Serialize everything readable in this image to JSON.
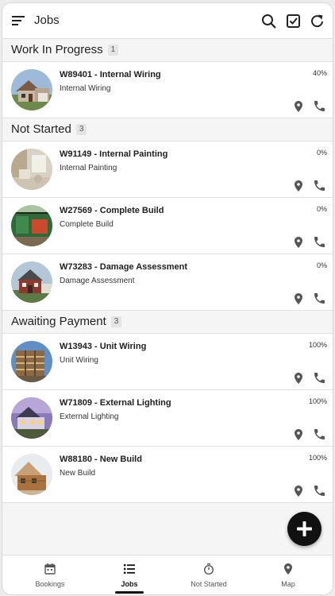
{
  "header": {
    "title": "Jobs",
    "menu_icon": "menu-icon",
    "actions": [
      "search-icon",
      "checklist-icon",
      "refresh-icon"
    ]
  },
  "sections": [
    {
      "title": "Work In Progress",
      "count": "1",
      "jobs": [
        {
          "name": "W89401 - Internal Wiring",
          "type": "Internal Wiring",
          "progress": "40%"
        }
      ]
    },
    {
      "title": "Not Started",
      "count": "3",
      "jobs": [
        {
          "name": "W91149 - Internal Painting",
          "type": "Internal Painting",
          "progress": "0%"
        },
        {
          "name": "W27569 - Complete Build",
          "type": "Complete Build",
          "progress": "0%"
        },
        {
          "name": "W73283 - Damage Assessment",
          "type": "Damage Assessment",
          "progress": "0%"
        }
      ]
    },
    {
      "title": "Awaiting Payment",
      "count": "3",
      "jobs": [
        {
          "name": "W13943 - Unit Wiring",
          "type": "Unit Wiring",
          "progress": "100%"
        },
        {
          "name": "W71809 - External Lighting",
          "type": "External Lighting",
          "progress": "100%"
        },
        {
          "name": "W88180 - New Build",
          "type": "New Build",
          "progress": "100%"
        }
      ]
    }
  ],
  "fab": {
    "icon": "plus-icon"
  },
  "bottom_nav": {
    "active": "Jobs",
    "tabs": [
      {
        "label": "Bookings",
        "icon": "calendar-icon"
      },
      {
        "label": "Jobs",
        "icon": "list-icon"
      },
      {
        "label": "Not Started",
        "icon": "stopwatch-icon"
      },
      {
        "label": "Map",
        "icon": "map-pin-icon"
      }
    ]
  },
  "colors": {
    "background": "#f5f5f5",
    "surface": "#ffffff",
    "accent": "#111111",
    "icon_gray": "#555555"
  }
}
